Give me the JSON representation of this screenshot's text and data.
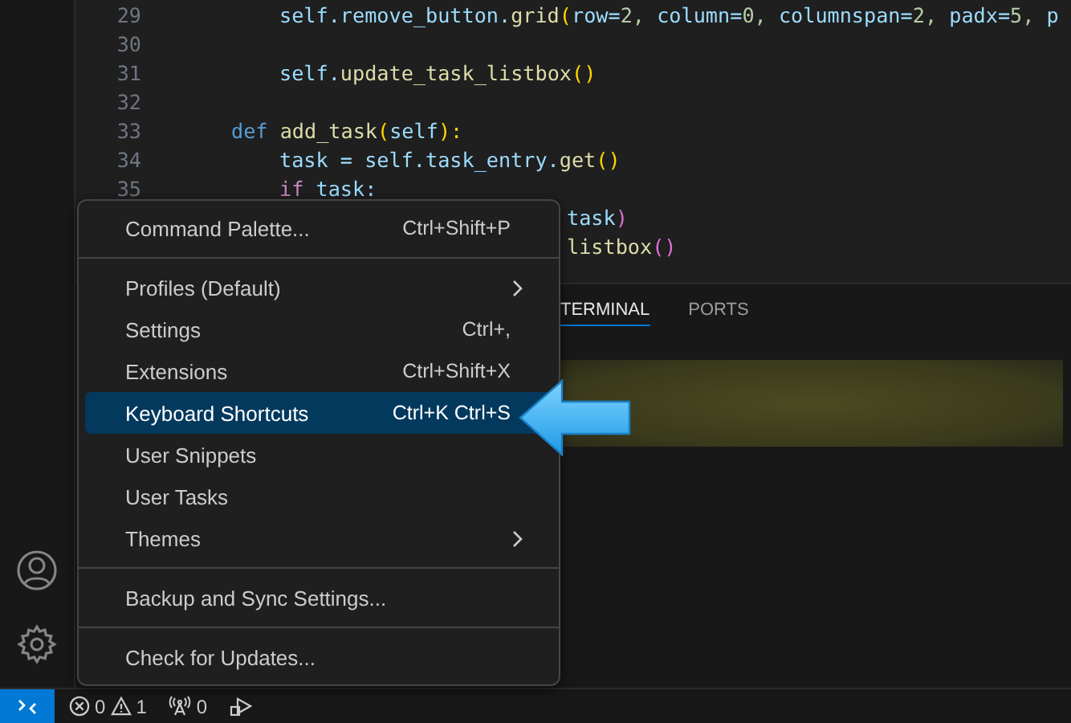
{
  "editor": {
    "lines": [
      {
        "number": "29",
        "kind": "body",
        "tokens": [
          {
            "text": "self.remove_button.",
            "kind": "var"
          },
          {
            "text": "grid",
            "kind": "func"
          },
          {
            "text": "(",
            "kind": "paren"
          },
          {
            "text": "row=",
            "kind": "var"
          },
          {
            "text": "2,",
            "kind": "num"
          },
          {
            "text": " column=",
            "kind": "var"
          },
          {
            "text": "0,",
            "kind": "num"
          },
          {
            "text": " columnspan=",
            "kind": "var"
          },
          {
            "text": "2,",
            "kind": "num"
          },
          {
            "text": " padx=",
            "kind": "var"
          },
          {
            "text": "5,",
            "kind": "num"
          },
          {
            "text": " p",
            "kind": "var"
          }
        ]
      },
      {
        "number": "30",
        "kind": "blank"
      },
      {
        "number": "31",
        "kind": "body",
        "tokens": [
          {
            "text": "self.",
            "kind": "var"
          },
          {
            "text": "update_task_listbox",
            "kind": "func"
          },
          {
            "text": "()",
            "kind": "paren"
          }
        ]
      },
      {
        "number": "32",
        "kind": "blank"
      },
      {
        "number": "33",
        "kind": "def",
        "tokens": [
          {
            "text": "def",
            "kind": "keyword"
          },
          {
            "text": " add_task",
            "kind": "func"
          },
          {
            "text": "(",
            "kind": "paren"
          },
          {
            "text": "self",
            "kind": "var"
          },
          {
            "text": "):",
            "kind": "paren"
          }
        ]
      },
      {
        "number": "34",
        "kind": "body",
        "tokens": [
          {
            "text": "task = self.task_entry.",
            "kind": "var"
          },
          {
            "text": "get",
            "kind": "func"
          },
          {
            "text": "()",
            "kind": "paren"
          }
        ]
      },
      {
        "number": "35",
        "kind": "body",
        "tokens": [
          {
            "text": "if",
            "kind": "control"
          },
          {
            "text": " task:",
            "kind": "var"
          }
        ]
      },
      {
        "kind": "partial",
        "tokens": [
          {
            "text": "task",
            "kind": "var"
          },
          {
            "text": ")",
            "kind": "paren2"
          }
        ]
      },
      {
        "kind": "partial",
        "tokens": [
          {
            "text": "listbox",
            "kind": "func"
          },
          {
            "text": "()",
            "kind": "paren2"
          }
        ]
      }
    ]
  },
  "panel": {
    "tabs": [
      {
        "label": "TERMINAL",
        "selected": true
      },
      {
        "label": "PORTS",
        "selected": false
      }
    ]
  },
  "menu": {
    "groups": [
      [
        {
          "label": "Command Palette...",
          "shortcut": "Ctrl+Shift+P",
          "submenu": false,
          "selected": false
        }
      ],
      [
        {
          "label": "Profiles (Default)",
          "submenu": true,
          "selected": false
        },
        {
          "label": "Settings",
          "shortcut": "Ctrl+,",
          "submenu": false,
          "selected": false
        },
        {
          "label": "Extensions",
          "shortcut": "Ctrl+Shift+X",
          "submenu": false,
          "selected": false
        },
        {
          "label": "Keyboard Shortcuts",
          "shortcut": "Ctrl+K Ctrl+S",
          "submenu": false,
          "selected": true
        },
        {
          "label": "User Snippets",
          "submenu": false,
          "selected": false
        },
        {
          "label": "User Tasks",
          "submenu": false,
          "selected": false
        },
        {
          "label": "Themes",
          "submenu": true,
          "selected": false
        }
      ],
      [
        {
          "label": "Backup and Sync Settings...",
          "submenu": false,
          "selected": false
        }
      ],
      [
        {
          "label": "Check for Updates...",
          "submenu": false,
          "selected": false
        }
      ]
    ]
  },
  "status_bar": {
    "errors": "0",
    "warnings": "1",
    "ports": "0"
  }
}
